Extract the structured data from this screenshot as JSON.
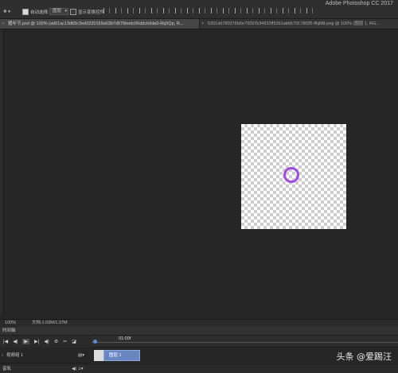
{
  "app": {
    "title": "Adobe Photoshop CC 2017"
  },
  "options_bar": {
    "auto_select_label": "自动选择:",
    "auto_select_value": "图层",
    "show_transform_label": "显示变换控件"
  },
  "tabs": [
    {
      "label": "猪年节.psd @ 100% (ad01ac13d65c3ed3220169a63b7d575bedc06ddcb9da0-Rq5Qp, R..."
    },
    {
      "label": "5351dd780376b5e70297b34932ff53b1abb579178f2f5-lfkjM8.png @ 100% (图层 1, RG..."
    }
  ],
  "status": {
    "zoom": "100%",
    "doc_info": "文档:1.03M/1.37M"
  },
  "timeline": {
    "title": "时间轴",
    "time_marker": "01:00f",
    "track_label": "视频组 1",
    "clip_label": "图层 1",
    "audio_label": "音轨"
  },
  "watermark": "头条 @爱踢汪",
  "colors": {
    "ring": "#a24be0",
    "clip": "#6a86c0",
    "playhead": "#5a8fd6"
  }
}
